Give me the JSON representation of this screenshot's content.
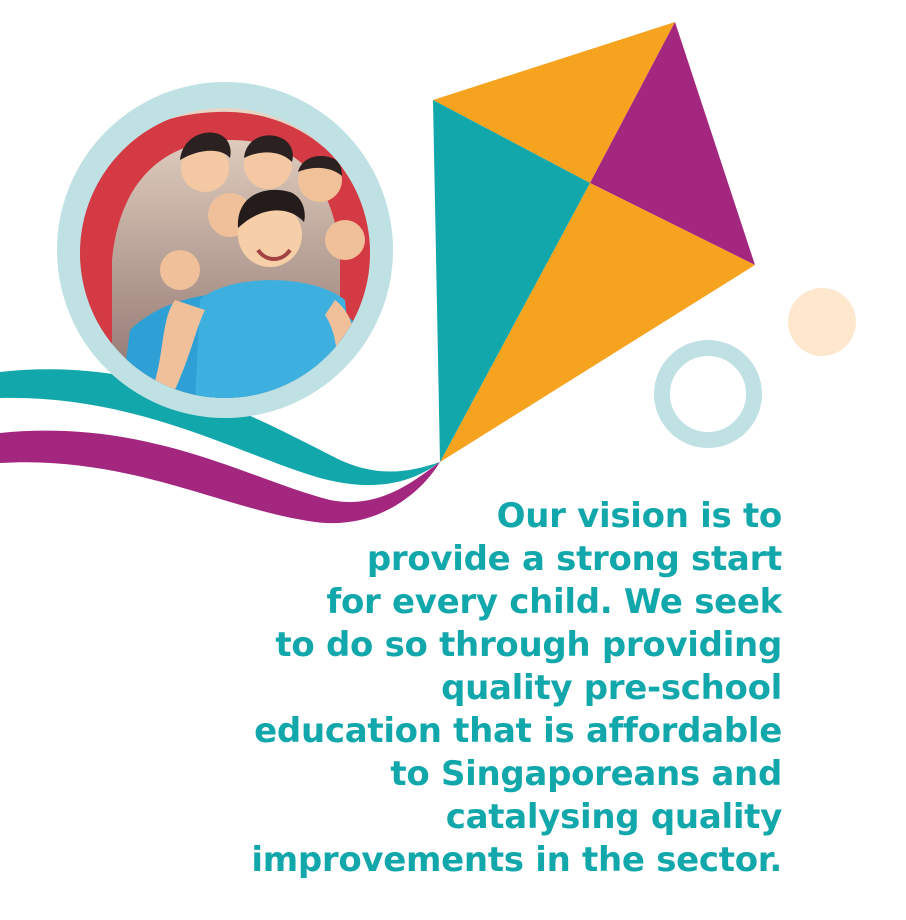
{
  "colors": {
    "teal": "#12a7ab",
    "orange": "#f6a31f",
    "purple": "#a3267f",
    "light_blue": "#bfe1e4",
    "peach": "#fde7cd"
  },
  "photo": {
    "description_icon": "children-playing-photo"
  },
  "vision": {
    "lines": [
      "Our vision is to",
      "provide a strong start",
      "for every child. We seek",
      "to do so through providing",
      "quality pre-school",
      "education that is affordable",
      "to Singaporeans and",
      "catalysing quality",
      "improvements in the sector."
    ]
  }
}
